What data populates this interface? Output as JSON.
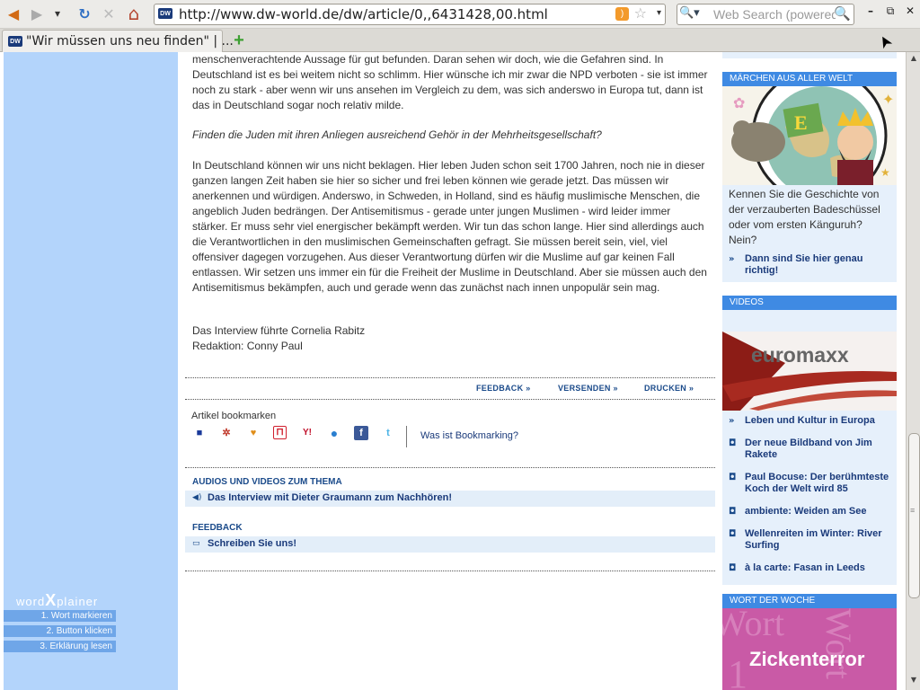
{
  "browser": {
    "url": "http://www.dw-world.de/dw/article/0,,6431428,00.html",
    "favicon_text": "DW",
    "search_placeholder": "Web Search (powered",
    "tab_title": "\"Wir müssen uns neu finden\" | ...",
    "icons": {
      "back": "◀",
      "forward": "▶",
      "history": "▾",
      "reload": "↻",
      "stop": "✕",
      "home": "⌂",
      "rss": ")",
      "star": "☆",
      "dropdown": "▾",
      "search_engine": "🔍▾",
      "search_go": "🔍",
      "minimize": "–",
      "maximize": "⧉",
      "close": "✕",
      "new_tab": "+",
      "cursor": "➤"
    }
  },
  "article": {
    "p1": "menschenverachtende Aussage für gut befunden. Daran sehen wir doch, wie die Gefahren sind. In Deutschland ist es bei weitem nicht so schlimm. Hier wünsche ich mir zwar die NPD verboten - sie ist immer noch zu stark - aber wenn wir uns ansehen im Vergleich zu dem, was sich anderswo in Europa tut, dann ist das in Deutschland sogar noch relativ milde.",
    "question": "Finden die Juden mit ihren Anliegen ausreichend Gehör in der Mehrheitsgesellschaft?",
    "p2": "In Deutschland können wir uns nicht beklagen. Hier leben Juden schon seit 1700 Jahren, noch nie in dieser ganzen langen Zeit haben sie hier so sicher und frei leben können wie gerade jetzt. Das müssen wir anerkennen und würdigen. Anderswo, in Schweden, in Holland, sind es häufig muslimische Menschen, die angeblich Juden bedrängen. Der Antisemitismus - gerade unter jungen Muslimen - wird leider immer stärker. Er muss sehr viel energischer bekämpft werden. Wir tun das schon lange. Hier sind allerdings auch die Verantwortlichen in den muslimischen Gemeinschaften gefragt. Sie müssen bereit sein, viel, viel offensiver dagegen vorzugehen. Aus dieser Verantwortung dürfen wir die Muslime auf gar keinen Fall entlassen. Wir setzen uns immer ein für die Freiheit der Muslime in Deutschland. Aber sie müssen auch den Antisemitismus bekämpfen, auch und gerade wenn das zunächst nach innen unpopulär sein mag.",
    "credit1": "Das Interview führte Cornelia Rabitz",
    "credit2": "Redaktion: Conny Paul",
    "actions": {
      "feedback": "FEEDBACK »",
      "send": "VERSENDEN »",
      "print": "DRUCKEN »"
    },
    "bookmarks": {
      "title": "Artikel bookmarken",
      "help": "Was ist Bookmarking?",
      "icons": [
        "■",
        "✲",
        "♥",
        "⊓",
        "Y!",
        "●",
        "f",
        "t"
      ]
    },
    "av_section": {
      "title": "AUDIOS UND VIDEOS ZUM THEMA",
      "icon": "◀)",
      "item": "Das Interview mit Dieter Graumann zum Nachhören!"
    },
    "feedback_section": {
      "title": "FEEDBACK",
      "icon": "▭",
      "item": "Schreiben Sie uns!"
    }
  },
  "wordxplainer": {
    "brand_word": "word",
    "brand_x": "X",
    "brand_plainer": "plainer",
    "steps": [
      "1. Wort markieren",
      "2. Button klicken",
      "3. Erklärung lesen"
    ]
  },
  "sidebar": {
    "maerchen": {
      "title": "MÄRCHEN AUS ALLER WELT",
      "text": "Kennen Sie die Geschichte von der verzauberten Badeschüssel oder vom ersten Känguruh? Nein?",
      "link": "Dann sind Sie hier genau richtig!",
      "link_icon": "»"
    },
    "videos": {
      "title": "VIDEOS",
      "banner": "euromaxx",
      "items": [
        {
          "icon": "»",
          "label": "Leben und Kultur in Europa"
        },
        {
          "icon": "◘",
          "label": "Der neue Bildband von Jim Rakete"
        },
        {
          "icon": "◘",
          "label": "Paul Bocuse: Der berühmteste Koch der Welt wird 85"
        },
        {
          "icon": "◘",
          "label": "ambiente: Weiden am See"
        },
        {
          "icon": "◘",
          "label": "Wellenreiten im Winter: River Surfing"
        },
        {
          "icon": "◘",
          "label": "à la carte: Fasan in Leeds"
        }
      ]
    },
    "wort": {
      "title": "WORT DER WOCHE",
      "banner": "Zickenterror"
    }
  },
  "scrollbar": {
    "up": "▲",
    "down": "▼",
    "grip": "≡"
  },
  "colors": {
    "left_column": "#b3d4fb",
    "sidebar_header": "#3f8ae3",
    "link": "#1a3a7a",
    "section_row": "#e3eef9"
  }
}
